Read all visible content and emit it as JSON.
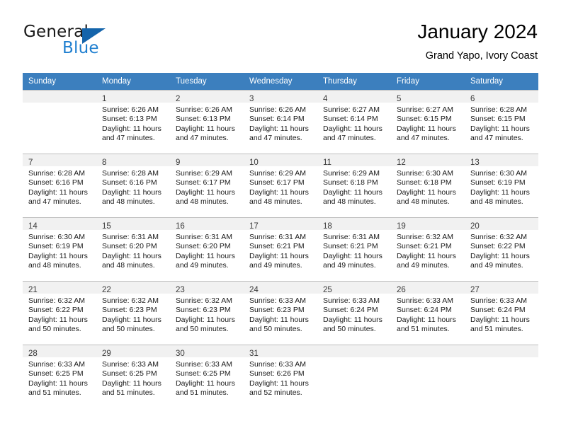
{
  "brand": {
    "name_part1": "General",
    "name_part2": "Blue",
    "triangle_icon": "triangle-icon",
    "accent_color": "#1f7fd0",
    "triangle_color": "#1464ab"
  },
  "header": {
    "title": "January 2024",
    "subtitle": "Grand Yapo, Ivory Coast"
  },
  "calendar": {
    "header_bg": "#3c7fbe",
    "header_text_color": "#ffffff",
    "daynum_bg": "#f1f1f1",
    "weekdays": [
      "Sunday",
      "Monday",
      "Tuesday",
      "Wednesday",
      "Thursday",
      "Friday",
      "Saturday"
    ],
    "weeks": [
      [
        {
          "day": "",
          "lines": []
        },
        {
          "day": "1",
          "lines": [
            "Sunrise: 6:26 AM",
            "Sunset: 6:13 PM",
            "Daylight: 11 hours",
            "and 47 minutes."
          ]
        },
        {
          "day": "2",
          "lines": [
            "Sunrise: 6:26 AM",
            "Sunset: 6:13 PM",
            "Daylight: 11 hours",
            "and 47 minutes."
          ]
        },
        {
          "day": "3",
          "lines": [
            "Sunrise: 6:26 AM",
            "Sunset: 6:14 PM",
            "Daylight: 11 hours",
            "and 47 minutes."
          ]
        },
        {
          "day": "4",
          "lines": [
            "Sunrise: 6:27 AM",
            "Sunset: 6:14 PM",
            "Daylight: 11 hours",
            "and 47 minutes."
          ]
        },
        {
          "day": "5",
          "lines": [
            "Sunrise: 6:27 AM",
            "Sunset: 6:15 PM",
            "Daylight: 11 hours",
            "and 47 minutes."
          ]
        },
        {
          "day": "6",
          "lines": [
            "Sunrise: 6:28 AM",
            "Sunset: 6:15 PM",
            "Daylight: 11 hours",
            "and 47 minutes."
          ]
        }
      ],
      [
        {
          "day": "7",
          "lines": [
            "Sunrise: 6:28 AM",
            "Sunset: 6:16 PM",
            "Daylight: 11 hours",
            "and 47 minutes."
          ]
        },
        {
          "day": "8",
          "lines": [
            "Sunrise: 6:28 AM",
            "Sunset: 6:16 PM",
            "Daylight: 11 hours",
            "and 48 minutes."
          ]
        },
        {
          "day": "9",
          "lines": [
            "Sunrise: 6:29 AM",
            "Sunset: 6:17 PM",
            "Daylight: 11 hours",
            "and 48 minutes."
          ]
        },
        {
          "day": "10",
          "lines": [
            "Sunrise: 6:29 AM",
            "Sunset: 6:17 PM",
            "Daylight: 11 hours",
            "and 48 minutes."
          ]
        },
        {
          "day": "11",
          "lines": [
            "Sunrise: 6:29 AM",
            "Sunset: 6:18 PM",
            "Daylight: 11 hours",
            "and 48 minutes."
          ]
        },
        {
          "day": "12",
          "lines": [
            "Sunrise: 6:30 AM",
            "Sunset: 6:18 PM",
            "Daylight: 11 hours",
            "and 48 minutes."
          ]
        },
        {
          "day": "13",
          "lines": [
            "Sunrise: 6:30 AM",
            "Sunset: 6:19 PM",
            "Daylight: 11 hours",
            "and 48 minutes."
          ]
        }
      ],
      [
        {
          "day": "14",
          "lines": [
            "Sunrise: 6:30 AM",
            "Sunset: 6:19 PM",
            "Daylight: 11 hours",
            "and 48 minutes."
          ]
        },
        {
          "day": "15",
          "lines": [
            "Sunrise: 6:31 AM",
            "Sunset: 6:20 PM",
            "Daylight: 11 hours",
            "and 48 minutes."
          ]
        },
        {
          "day": "16",
          "lines": [
            "Sunrise: 6:31 AM",
            "Sunset: 6:20 PM",
            "Daylight: 11 hours",
            "and 49 minutes."
          ]
        },
        {
          "day": "17",
          "lines": [
            "Sunrise: 6:31 AM",
            "Sunset: 6:21 PM",
            "Daylight: 11 hours",
            "and 49 minutes."
          ]
        },
        {
          "day": "18",
          "lines": [
            "Sunrise: 6:31 AM",
            "Sunset: 6:21 PM",
            "Daylight: 11 hours",
            "and 49 minutes."
          ]
        },
        {
          "day": "19",
          "lines": [
            "Sunrise: 6:32 AM",
            "Sunset: 6:21 PM",
            "Daylight: 11 hours",
            "and 49 minutes."
          ]
        },
        {
          "day": "20",
          "lines": [
            "Sunrise: 6:32 AM",
            "Sunset: 6:22 PM",
            "Daylight: 11 hours",
            "and 49 minutes."
          ]
        }
      ],
      [
        {
          "day": "21",
          "lines": [
            "Sunrise: 6:32 AM",
            "Sunset: 6:22 PM",
            "Daylight: 11 hours",
            "and 50 minutes."
          ]
        },
        {
          "day": "22",
          "lines": [
            "Sunrise: 6:32 AM",
            "Sunset: 6:23 PM",
            "Daylight: 11 hours",
            "and 50 minutes."
          ]
        },
        {
          "day": "23",
          "lines": [
            "Sunrise: 6:32 AM",
            "Sunset: 6:23 PM",
            "Daylight: 11 hours",
            "and 50 minutes."
          ]
        },
        {
          "day": "24",
          "lines": [
            "Sunrise: 6:33 AM",
            "Sunset: 6:23 PM",
            "Daylight: 11 hours",
            "and 50 minutes."
          ]
        },
        {
          "day": "25",
          "lines": [
            "Sunrise: 6:33 AM",
            "Sunset: 6:24 PM",
            "Daylight: 11 hours",
            "and 50 minutes."
          ]
        },
        {
          "day": "26",
          "lines": [
            "Sunrise: 6:33 AM",
            "Sunset: 6:24 PM",
            "Daylight: 11 hours",
            "and 51 minutes."
          ]
        },
        {
          "day": "27",
          "lines": [
            "Sunrise: 6:33 AM",
            "Sunset: 6:24 PM",
            "Daylight: 11 hours",
            "and 51 minutes."
          ]
        }
      ],
      [
        {
          "day": "28",
          "lines": [
            "Sunrise: 6:33 AM",
            "Sunset: 6:25 PM",
            "Daylight: 11 hours",
            "and 51 minutes."
          ]
        },
        {
          "day": "29",
          "lines": [
            "Sunrise: 6:33 AM",
            "Sunset: 6:25 PM",
            "Daylight: 11 hours",
            "and 51 minutes."
          ]
        },
        {
          "day": "30",
          "lines": [
            "Sunrise: 6:33 AM",
            "Sunset: 6:25 PM",
            "Daylight: 11 hours",
            "and 51 minutes."
          ]
        },
        {
          "day": "31",
          "lines": [
            "Sunrise: 6:33 AM",
            "Sunset: 6:26 PM",
            "Daylight: 11 hours",
            "and 52 minutes."
          ]
        },
        {
          "day": "",
          "lines": []
        },
        {
          "day": "",
          "lines": []
        },
        {
          "day": "",
          "lines": []
        }
      ]
    ]
  }
}
